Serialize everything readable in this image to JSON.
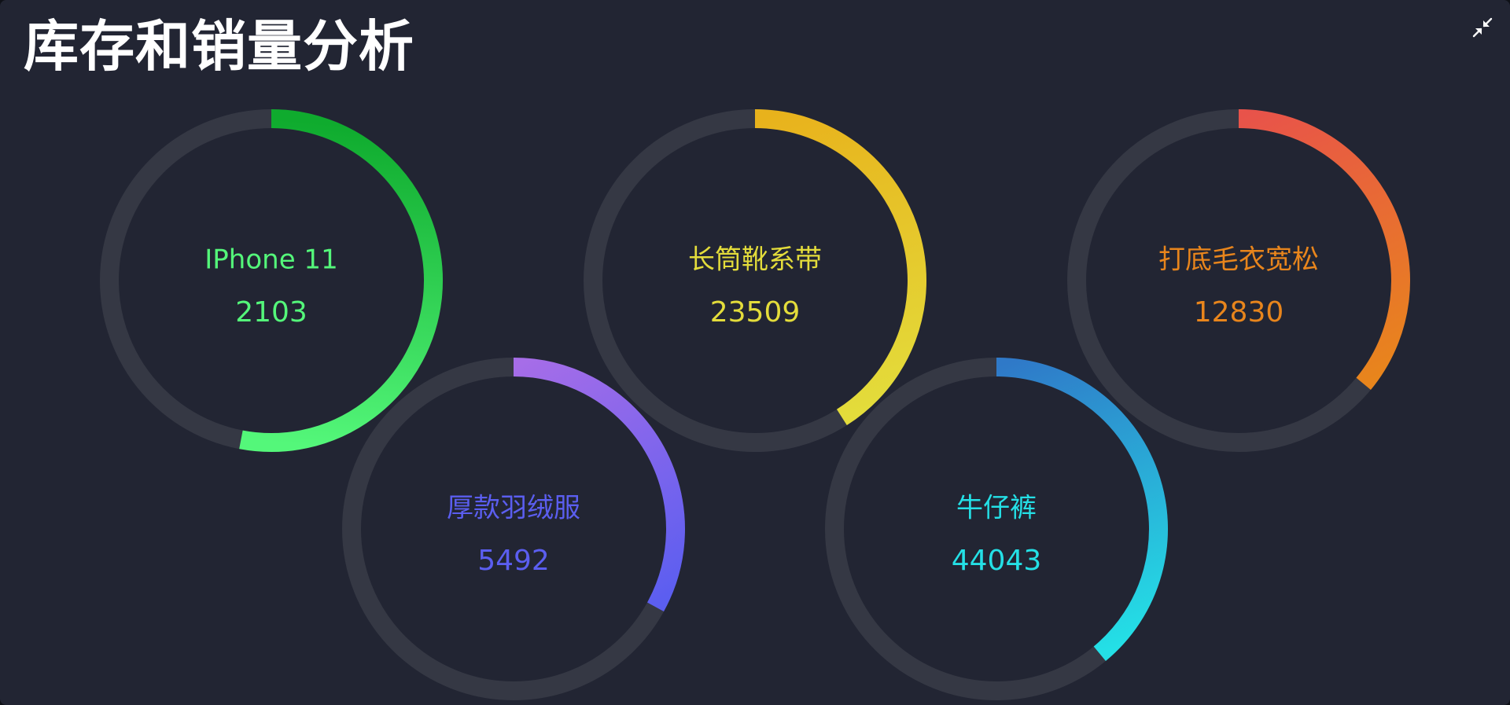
{
  "title": "库存和销量分析",
  "icons": {
    "collapse": "collapse-arrows-icon"
  },
  "colors": {
    "background": "#222533",
    "track": "#353844"
  },
  "chart_data": {
    "type": "gauge",
    "title": "库存和销量分析",
    "items": [
      {
        "name": "IPhone 11",
        "value": 2103,
        "fraction": 0.53,
        "color_start": "#0fab2e",
        "color_end": "#54f77a"
      },
      {
        "name": "长筒靴系带",
        "value": 23509,
        "fraction": 0.41,
        "color_start": "#e8b21c",
        "color_end": "#e3dc3b"
      },
      {
        "name": "打底毛衣宽松",
        "value": 12830,
        "fraction": 0.36,
        "color_start": "#e8534a",
        "color_end": "#e8851c"
      },
      {
        "name": "厚款羽绒服",
        "value": 5492,
        "fraction": 0.33,
        "color_start": "#a66de8",
        "color_end": "#5b5ef0"
      },
      {
        "name": "牛仔裤",
        "value": 44043,
        "fraction": 0.39,
        "color_start": "#2f79c8",
        "color_end": "#24e0e6"
      }
    ]
  }
}
